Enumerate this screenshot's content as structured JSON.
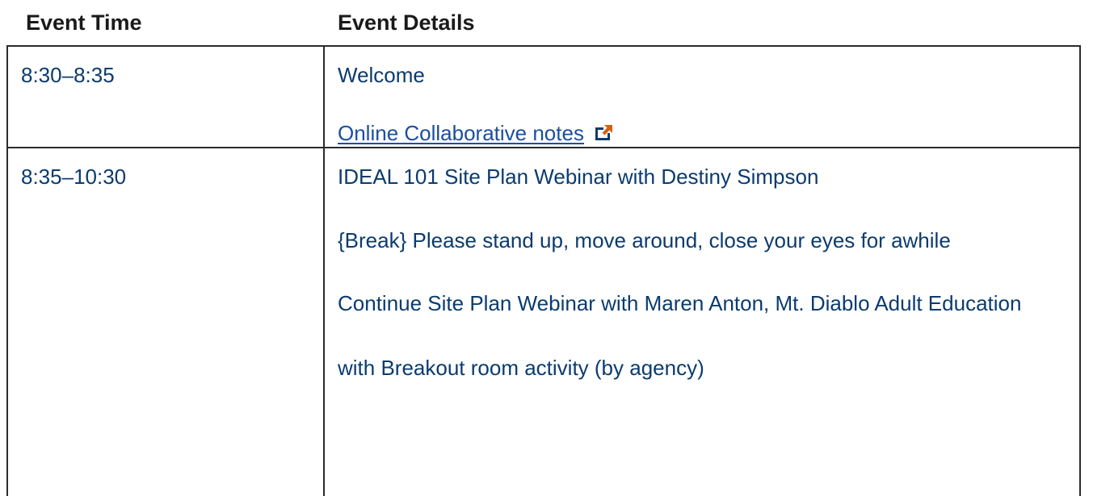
{
  "table": {
    "headers": {
      "time": "Event Time",
      "details": "Event Details"
    },
    "rows": [
      {
        "time": "8:30–8:35",
        "details": [
          "Welcome",
          "Online Collaborative notes"
        ]
      },
      {
        "time": "8:35–10:30",
        "details": [
          "IDEAL 101 Site Plan Webinar with Destiny Simpson",
          "{Break} Please stand up, move around, close your eyes for awhile",
          "Continue Site Plan Webinar with Maren Anton, Mt. Diablo Adult Education",
          "with Breakout room activity (by agency)"
        ]
      }
    ]
  },
  "icons": {
    "external_link": "external-link-icon"
  },
  "colors": {
    "body_text": "#0b3b6e",
    "link": "#1c4ea1",
    "header_text": "#1a1a1a",
    "border": "#2b2b2b",
    "icon_arrow": "#d4600f"
  }
}
